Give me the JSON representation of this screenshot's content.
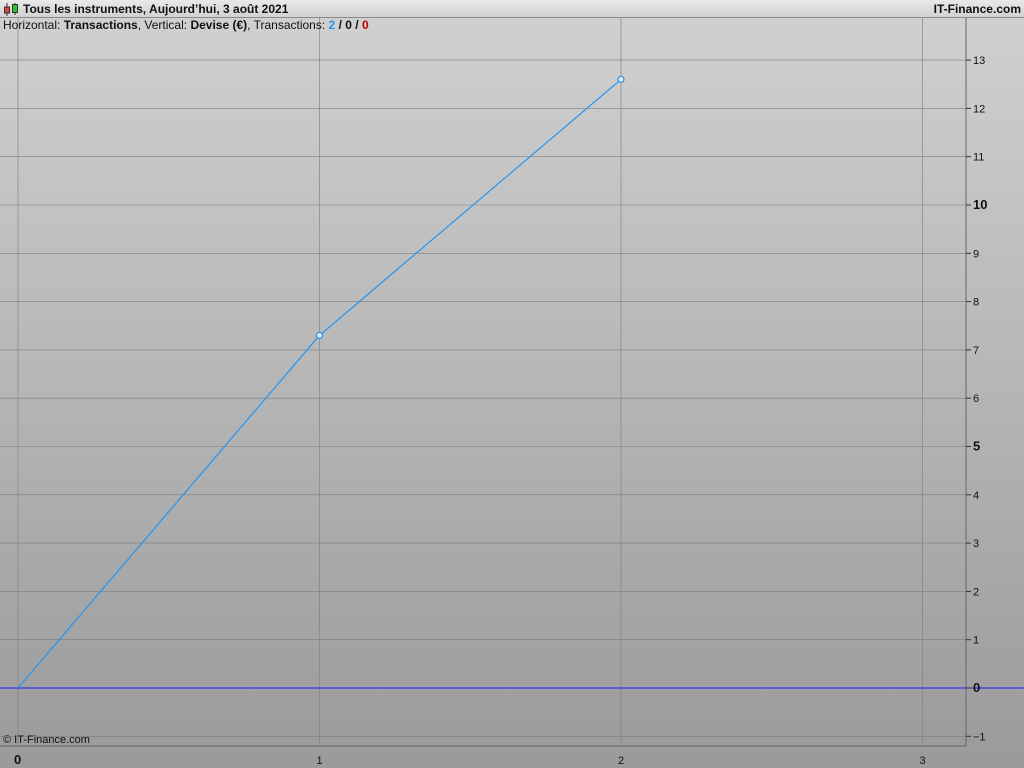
{
  "header": {
    "title": "Tous les instruments, Aujourd’hui, 3 août 2021",
    "brand": "IT-Finance.com",
    "icon": "candlestick-icon"
  },
  "info": {
    "horizontal_label": "Horizontal:",
    "horizontal_value": "Transactions",
    "vertical_label": "Vertical:",
    "vertical_value": "Devise (€)",
    "transactions_label": "Transactions:",
    "count_total": "2",
    "count_neutral": "0",
    "count_negative": "0",
    "separator": "/"
  },
  "copyright": "© IT-Finance.com",
  "colors": {
    "series": "#2196f3",
    "zero_line": "#1a1aff",
    "negative": "#c00000",
    "bg_top": "#d0d0d0",
    "bg_bottom": "#9a9a9a"
  },
  "chart_data": {
    "type": "line",
    "xlabel": "Transactions",
    "ylabel": "Devise (€)",
    "xlim": [
      0,
      3.15
    ],
    "ylim": [
      -1.2,
      13.8
    ],
    "x_ticks": [
      "0",
      "1",
      "2",
      "3"
    ],
    "y_ticks": [
      "−1",
      "0",
      "1",
      "2",
      "3",
      "4",
      "5",
      "6",
      "7",
      "8",
      "9",
      "10",
      "11",
      "12",
      "13"
    ],
    "y_tick_values": [
      -1,
      0,
      1,
      2,
      3,
      4,
      5,
      6,
      7,
      8,
      9,
      10,
      11,
      12,
      13
    ],
    "bold_y_ticks": [
      "0",
      "5",
      "10"
    ],
    "bold_x_ticks": [
      "0"
    ],
    "series": [
      {
        "x": [
          0,
          1,
          2
        ],
        "y": [
          0,
          7.3,
          12.6
        ],
        "markers": [
          false,
          true,
          true
        ]
      }
    ],
    "grid": true
  }
}
